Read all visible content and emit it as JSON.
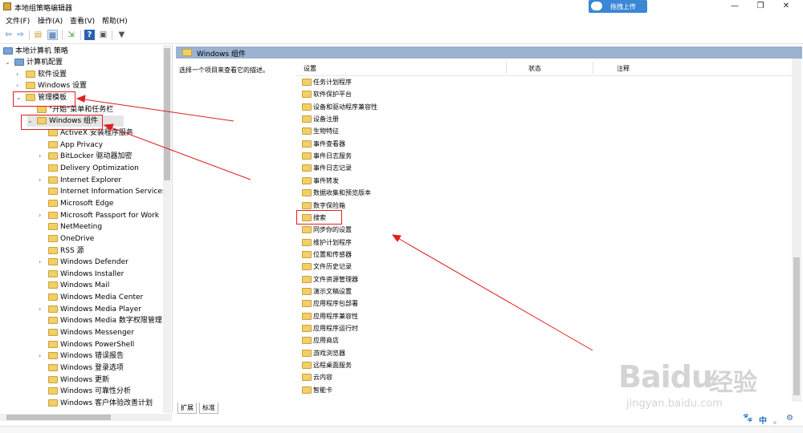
{
  "window": {
    "title": "本地组策略编辑器",
    "upload_label": "拖拽上传",
    "controls": [
      "—",
      "❐",
      "✕"
    ]
  },
  "menu": [
    "文件(F)",
    "操作(A)",
    "查看(V)",
    "帮助(H)"
  ],
  "toolbar_icons": [
    "back-icon",
    "forward-icon",
    "folder-up-icon",
    "show-hide-tree-icon",
    "export-icon",
    "help-icon",
    "properties-icon",
    "filter-icon"
  ],
  "tree": {
    "root": "本地计算机 策略",
    "computer_config": "计算机配置",
    "software_settings": "软件设置",
    "windows_settings": "Windows 设置",
    "admin_templates": "管理模板",
    "start_menu": "\"开始\"菜单和任务栏",
    "windows_components": "Windows 组件",
    "children": [
      {
        "label": "ActiveX 安装程序服务",
        "exp": false
      },
      {
        "label": "App Privacy",
        "exp": false
      },
      {
        "label": "BitLocker 驱动器加密",
        "exp": true
      },
      {
        "label": "Delivery Optimization",
        "exp": false
      },
      {
        "label": "Internet Explorer",
        "exp": true
      },
      {
        "label": "Internet Information Services",
        "exp": false
      },
      {
        "label": "Microsoft Edge",
        "exp": false
      },
      {
        "label": "Microsoft Passport for Work",
        "exp": true
      },
      {
        "label": "NetMeeting",
        "exp": false
      },
      {
        "label": "OneDrive",
        "exp": false
      },
      {
        "label": "RSS 源",
        "exp": false
      },
      {
        "label": "Windows Defender",
        "exp": true
      },
      {
        "label": "Windows Installer",
        "exp": false
      },
      {
        "label": "Windows Mail",
        "exp": false
      },
      {
        "label": "Windows Media Center",
        "exp": false
      },
      {
        "label": "Windows Media Player",
        "exp": true
      },
      {
        "label": "Windows Media 数字权限管理",
        "exp": false
      },
      {
        "label": "Windows Messenger",
        "exp": false
      },
      {
        "label": "Windows PowerShell",
        "exp": false
      },
      {
        "label": "Windows 错误报告",
        "exp": true
      },
      {
        "label": "Windows 登录选项",
        "exp": false
      },
      {
        "label": "Windows 更新",
        "exp": false
      },
      {
        "label": "Windows 可靠性分析",
        "exp": false
      },
      {
        "label": "Windows 客户体验改善计划",
        "exp": false
      }
    ]
  },
  "right": {
    "header_title": "Windows 组件",
    "description": "选择一个项目来查看它的描述。",
    "columns": {
      "setting": "设置",
      "state": "状态",
      "comment": "注释"
    },
    "items": [
      "任务计划程序",
      "软件保护平台",
      "设备和驱动程序兼容性",
      "设备注册",
      "生物特征",
      "事件查看器",
      "事件日志服务",
      "事件日志记录",
      "事件转发",
      "数据收集和预览版本",
      "数字保险箱",
      "搜索",
      "同步你的设置",
      "维护计划程序",
      "位置和传感器",
      "文件历史记录",
      "文件资源管理器",
      "演示文稿设置",
      "应用程序包部署",
      "应用程序兼容性",
      "应用程序运行时",
      "应用商店",
      "游戏浏览器",
      "远程桌面服务",
      "云内容",
      "智能卡"
    ],
    "tabs": [
      "扩展",
      "标准"
    ]
  },
  "watermark": {
    "brand": "Baidu",
    "sub": "经验",
    "url": "jingyan.baidu.com"
  },
  "ime": [
    "中",
    "。"
  ],
  "colors": {
    "accent": "#3b87d6",
    "annotation": "#e02020",
    "header": "#9bb2d1",
    "folder": "#f2cf67"
  }
}
